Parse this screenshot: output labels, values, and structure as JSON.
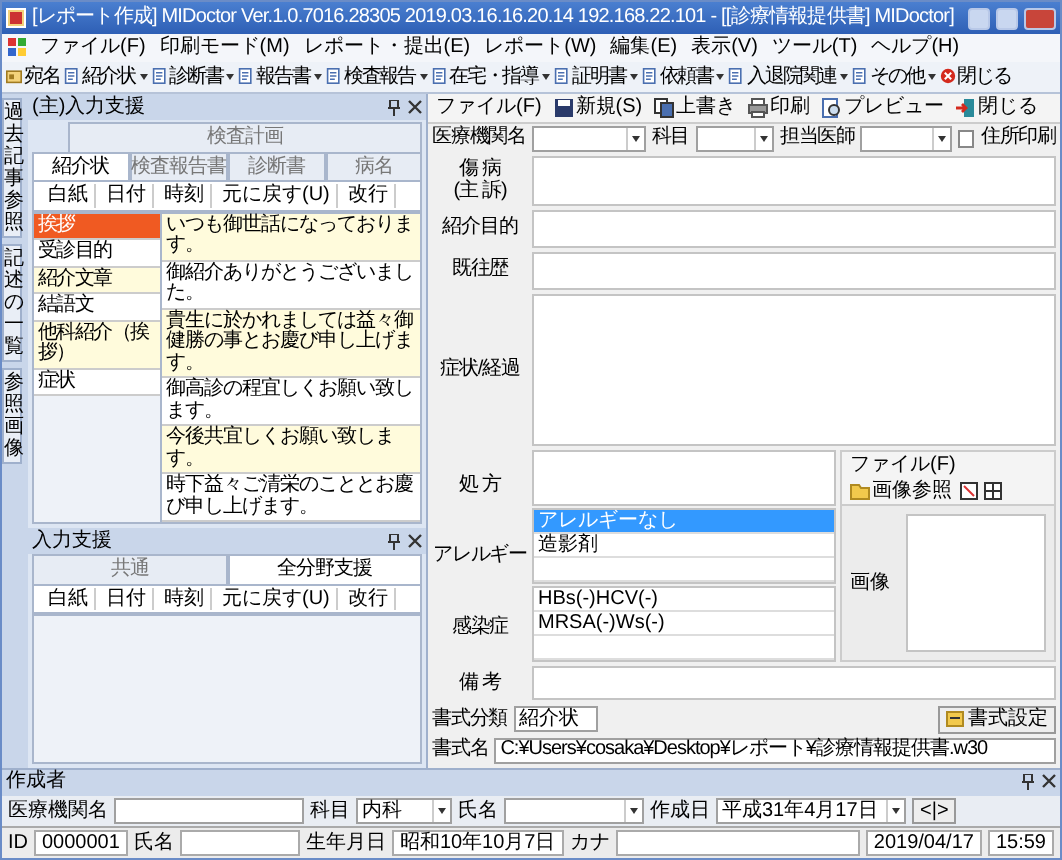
{
  "window": {
    "title": "[レポート作成] MIDoctor Ver.1.0.7016.28305 2019.03.16.16.20.14 192.168.22.101 - [[診療情報提供書] MIDoctor]"
  },
  "menu": [
    "ファイル(F)",
    "印刷モード(M)",
    "レポート・提出(E)",
    "レポート(W)",
    "編集(E)",
    "表示(V)",
    "ツール(T)",
    "ヘルプ(H)"
  ],
  "toolbar": [
    {
      "label": "宛名",
      "kind": "card",
      "dropdown": false
    },
    {
      "label": "紹介状",
      "kind": "doc",
      "dropdown": true
    },
    {
      "label": "診断書",
      "kind": "doc",
      "dropdown": true
    },
    {
      "label": "報告書",
      "kind": "doc",
      "dropdown": true
    },
    {
      "label": "検査報告",
      "kind": "doc",
      "dropdown": true
    },
    {
      "label": "在宅・指導",
      "kind": "doc",
      "dropdown": true
    },
    {
      "label": "証明書",
      "kind": "doc",
      "dropdown": true
    },
    {
      "label": "依頼書",
      "kind": "doc",
      "dropdown": true
    },
    {
      "label": "入退院関連",
      "kind": "doc",
      "dropdown": true
    },
    {
      "label": "その他",
      "kind": "doc",
      "dropdown": true
    },
    {
      "label": "閉じる",
      "kind": "close",
      "dropdown": false
    }
  ],
  "side_tabs": [
    {
      "label": "過去記事参照",
      "selected": false
    },
    {
      "label": "記述の一覧",
      "selected": false
    },
    {
      "label": "参照画像",
      "selected": false
    }
  ],
  "input_panel": {
    "title": "(主)入力支援",
    "tab_rows": [
      [
        {
          "label": "検査計画",
          "selected": false
        }
      ],
      [
        {
          "label": "紹介状",
          "selected": true
        },
        {
          "label": "検査報告書",
          "selected": false
        },
        {
          "label": "診断書",
          "selected": false
        },
        {
          "label": "病名",
          "selected": false
        }
      ]
    ],
    "tools": [
      "白紙",
      "日付",
      "時刻",
      "元に戻す(U)",
      "改行"
    ],
    "categories": [
      {
        "label": "挨拶",
        "selected": true
      },
      {
        "label": "受診目的",
        "selected": false
      },
      {
        "label": "紹介文章",
        "selected": false
      },
      {
        "label": "結語文",
        "selected": false
      },
      {
        "label": "他科紹介（挨拶）",
        "selected": false
      },
      {
        "label": "症状",
        "selected": false
      }
    ],
    "phrases": [
      "いつも御世話になっております。",
      "御紹介ありがとうございました。",
      "貴生に於かれましては益々御健勝の事とお慶び申し上げます。",
      "御高診の程宜しくお願い致します。",
      "今後共宜しくお願い致します。",
      "時下益々ご清栄のこととお慶び申し上げます。"
    ]
  },
  "sub_panel": {
    "title": "入力支援",
    "tabs": [
      {
        "label": "共通",
        "selected": false
      },
      {
        "label": "全分野支援",
        "selected": true
      }
    ],
    "tools": [
      "白紙",
      "日付",
      "時刻",
      "元に戻す(U)",
      "改行"
    ]
  },
  "form": {
    "toolbar": [
      {
        "label": "ファイル(F)",
        "kind": "text"
      },
      {
        "label": "新規(S)",
        "kind": "save"
      },
      {
        "label": "上書き",
        "kind": "copy"
      },
      {
        "label": "印刷",
        "kind": "print"
      },
      {
        "label": "プレビュー",
        "kind": "preview"
      },
      {
        "label": "閉じる",
        "kind": "exit"
      }
    ],
    "header_fields": [
      {
        "label": "医療機関名"
      },
      {
        "label": "科目"
      },
      {
        "label": "担当医師"
      }
    ],
    "address_print": {
      "label": "住所印刷",
      "checked": false
    },
    "sections": [
      {
        "lines": [
          "傷 病",
          "(主 訴)"
        ]
      },
      {
        "lines": [
          "紹介目的"
        ]
      },
      {
        "lines": [
          "既往歴"
        ]
      },
      {
        "lines": [
          "症状/経過"
        ]
      }
    ],
    "prescription_label": "処 方",
    "allergy": {
      "label": "アレルギー",
      "items": [
        {
          "text": "アレルギーなし",
          "selected": true
        },
        {
          "text": "造影剤",
          "selected": false
        }
      ]
    },
    "infection": {
      "label": "感染症",
      "items": [
        {
          "text": "HBs(-)HCV(-)",
          "selected": false
        },
        {
          "text": "MRSA(-)Ws(-)",
          "selected": false
        }
      ]
    },
    "image_panel": {
      "toolbar": [
        "ファイル(F)",
        "画像参照"
      ],
      "label": "画像"
    },
    "remarks_label": "備 考",
    "format_class": {
      "label": "書式分類",
      "value": "紹介状"
    },
    "format_name": {
      "label": "書式名",
      "value": "C:¥Users¥cosaka¥Desktop¥レポート¥診療情報提供書.w30"
    },
    "format_button": "書式設定"
  },
  "creator_panel": {
    "title": "作成者",
    "fields": [
      {
        "label": "医療機関名",
        "kind": "text"
      },
      {
        "label": "科目",
        "value": "内科",
        "kind": "combo"
      },
      {
        "label": "氏名",
        "kind": "combo"
      },
      {
        "label": "作成日",
        "value": "平成31年4月17日",
        "kind": "combo"
      }
    ],
    "nav": "<|>"
  },
  "status_bar": {
    "id_label": "ID",
    "id": "0000001",
    "name_label": "氏名",
    "birth_label": "生年月日",
    "birth": "昭和10年10月7日",
    "kana_label": "カナ",
    "date": "2019/04/17",
    "time": "15:59"
  }
}
